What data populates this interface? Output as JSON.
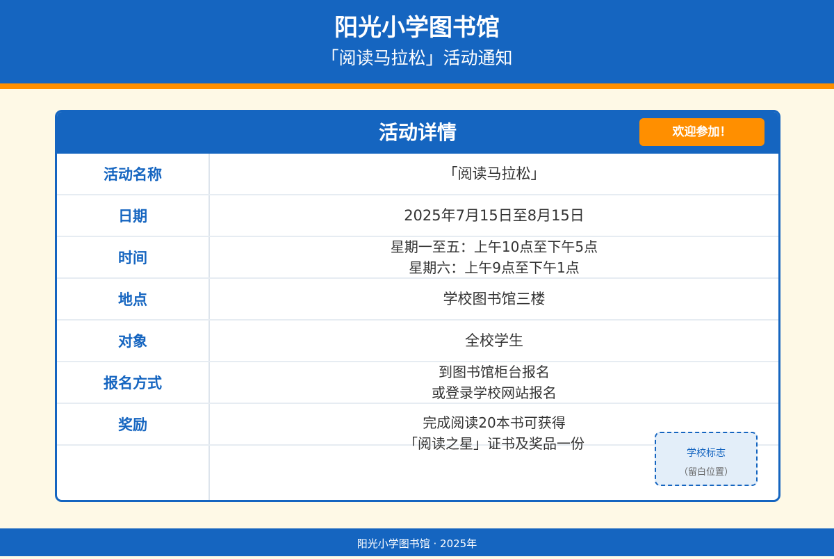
{
  "header": {
    "school_name": "阳光小学图书馆",
    "notice_title": "「阅读马拉松」活动通知"
  },
  "card": {
    "title": "活动详情",
    "badge": "欢迎参加！",
    "rows": [
      {
        "label": "活动名称",
        "lines": [
          "「阅读马拉松」"
        ]
      },
      {
        "label": "日期",
        "lines": [
          "2025年7月15日至8月15日"
        ]
      },
      {
        "label": "时间",
        "lines": [
          "星期一至五：上午10点至下午5点",
          "星期六：上午9点至下午1点"
        ]
      },
      {
        "label": "地点",
        "lines": [
          "学校图书馆三楼"
        ]
      },
      {
        "label": "对象",
        "lines": [
          "全校学生"
        ]
      },
      {
        "label": "报名方式",
        "lines": [
          "到图书馆柜台报名",
          "或登录学校网站报名"
        ]
      },
      {
        "label": "奖励",
        "lines": [
          "完成阅读20本书可获得",
          "「阅读之星」证书及奖品一份"
        ]
      }
    ],
    "logo_placeholder": {
      "title": "学校标志",
      "subtitle": "（留白位置）"
    }
  },
  "footer": {
    "text": "阳光小学图书馆 · 2025年"
  },
  "colors": {
    "primary": "#1565C0",
    "accent": "#FF8F00",
    "background": "#FEF9E6"
  }
}
